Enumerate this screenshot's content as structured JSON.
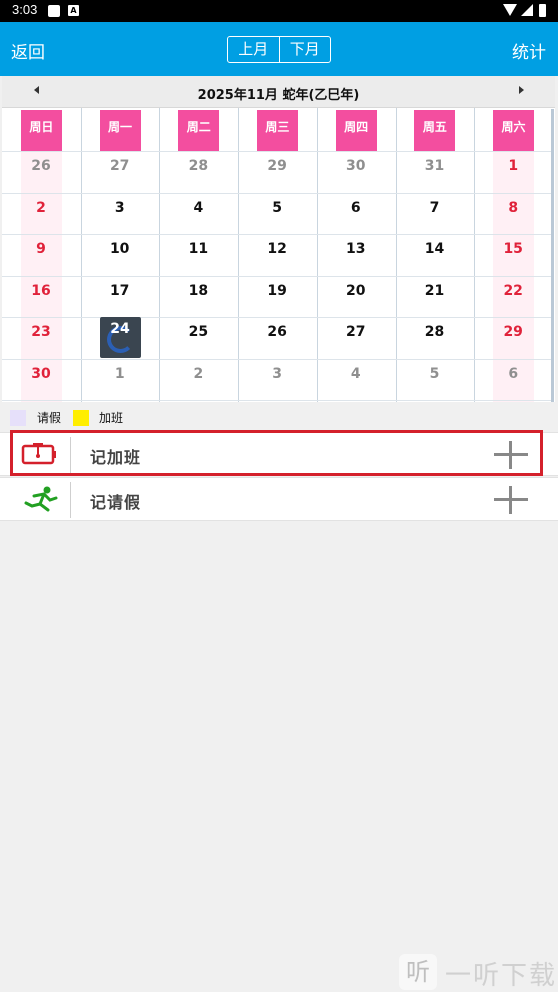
{
  "status_bar": {
    "time": "3:03",
    "icon_label": "A"
  },
  "top_bar": {
    "back": "返回",
    "prev_month": "上月",
    "next_month": "下月",
    "stats": "统计"
  },
  "calendar": {
    "title": "2025年11月   蛇年(乙巳年)",
    "weekdays": [
      "周日",
      "周一",
      "周二",
      "周三",
      "周四",
      "周五",
      "周六"
    ],
    "weeks": [
      [
        "26",
        "27",
        "28",
        "29",
        "30",
        "31",
        "1"
      ],
      [
        "2",
        "3",
        "4",
        "5",
        "6",
        "7",
        "8"
      ],
      [
        "9",
        "10",
        "11",
        "12",
        "13",
        "14",
        "15"
      ],
      [
        "16",
        "17",
        "18",
        "19",
        "20",
        "21",
        "22"
      ],
      [
        "23",
        "24",
        "25",
        "26",
        "27",
        "28",
        "29"
      ],
      [
        "30",
        "1",
        "2",
        "3",
        "4",
        "5",
        "6"
      ]
    ],
    "today": "24"
  },
  "legend": {
    "leave_label": "请假",
    "leave_color": "#e6e0fa",
    "overtime_label": "加班",
    "overtime_color": "#ffee00"
  },
  "actions": {
    "overtime": {
      "label": "记加班",
      "icon": "alarm-clock-icon",
      "color": "#d4202b"
    },
    "leave": {
      "label": "记请假",
      "icon": "running-man-icon",
      "color": "#22a022"
    }
  },
  "watermark": {
    "glyph": "听",
    "text": "一听下载"
  }
}
